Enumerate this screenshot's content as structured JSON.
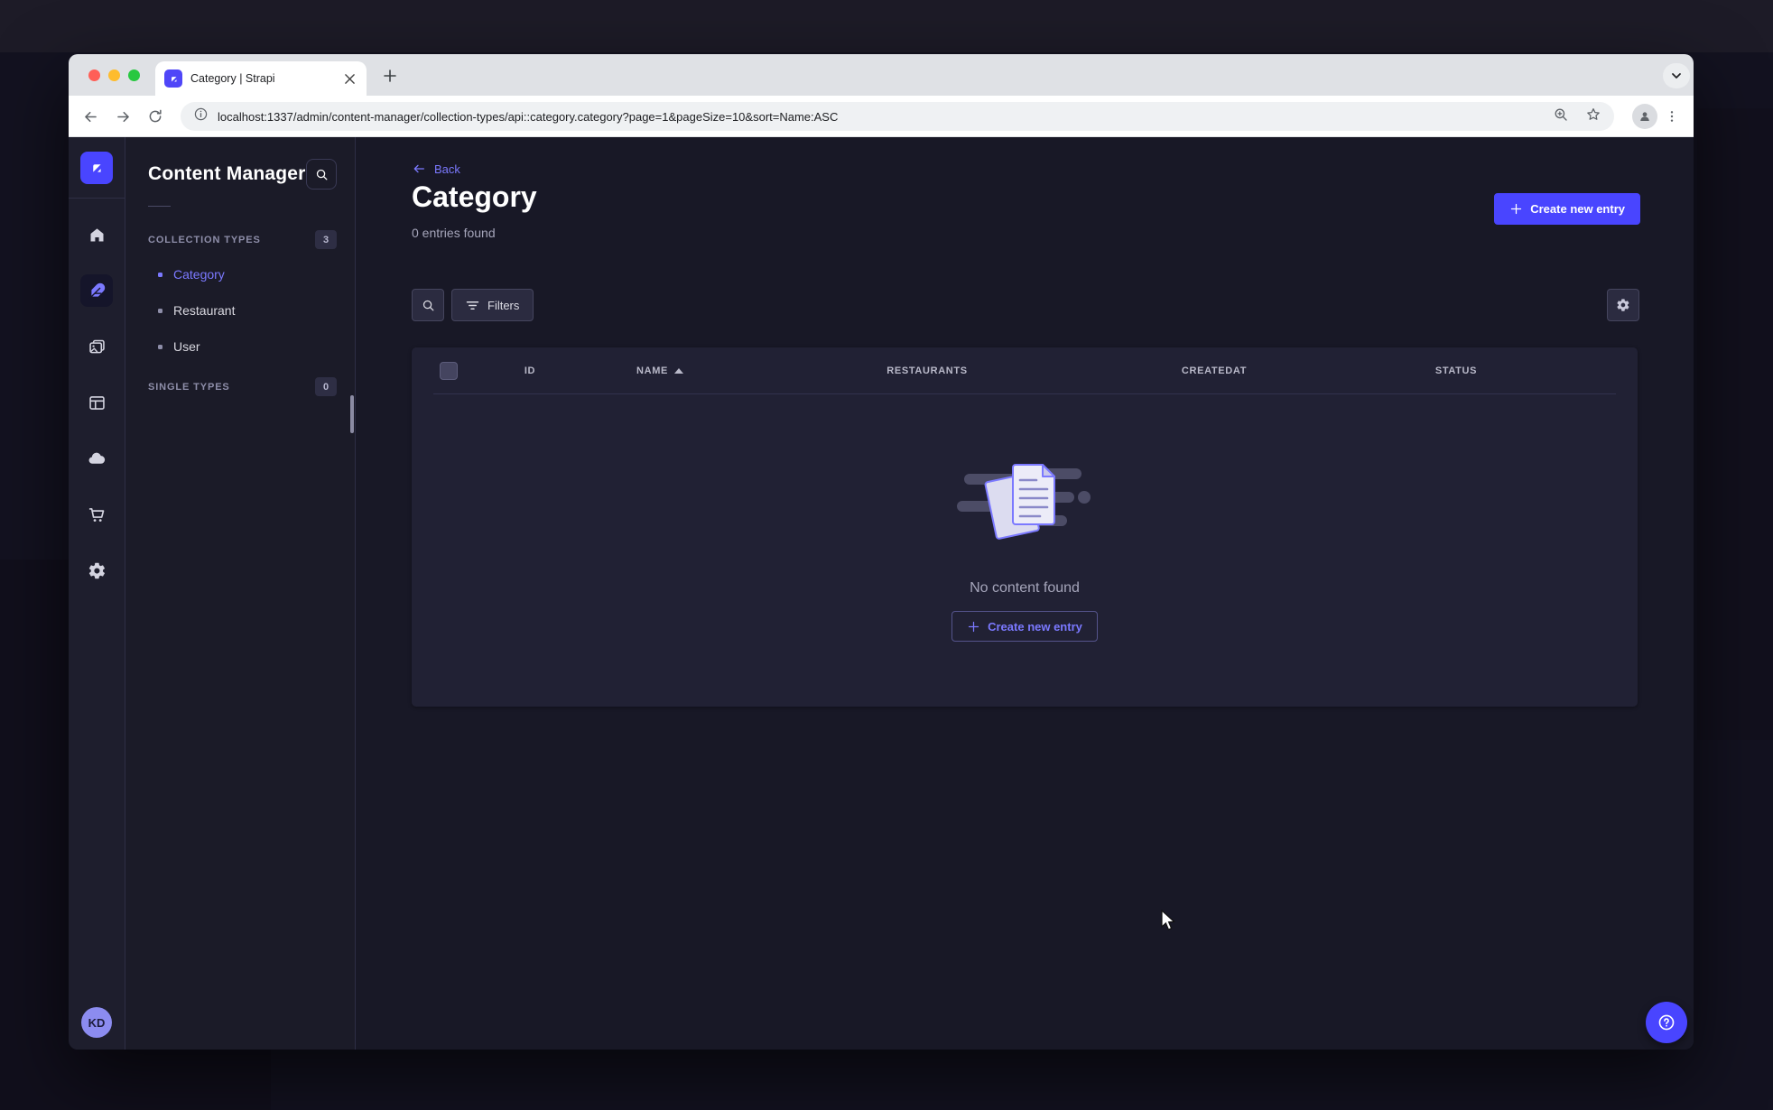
{
  "browser": {
    "tab_title": "Category | Strapi",
    "url": "localhost:1337/admin/content-manager/collection-types/api::category.category?page=1&pageSize=10&sort=Name:ASC"
  },
  "nav_rail": {
    "avatar_initials": "KD",
    "icons": [
      "strapi-logo",
      "home",
      "content-manager-feather",
      "media-library",
      "content-type-builder",
      "deploy-cloud",
      "marketplace-cart",
      "settings-gear"
    ]
  },
  "subnav": {
    "title": "Content Manager",
    "sections": [
      {
        "label": "COLLECTION TYPES",
        "badge": "3",
        "items": [
          {
            "label": "Category",
            "active": true
          },
          {
            "label": "Restaurant",
            "active": false
          },
          {
            "label": "User",
            "active": false
          }
        ]
      },
      {
        "label": "SINGLE TYPES",
        "badge": "0",
        "items": []
      }
    ]
  },
  "main": {
    "back_label": "Back",
    "title": "Category",
    "subtitle": "0 entries found",
    "create_button_label": "Create new entry",
    "filters_label": "Filters",
    "table": {
      "columns": [
        "ID",
        "NAME",
        "RESTAURANTS",
        "CREATEDAT",
        "STATUS"
      ],
      "sorted_column": "NAME",
      "sort_direction": "asc",
      "rows": []
    },
    "empty": {
      "message": "No content found",
      "button_label": "Create new entry"
    }
  },
  "colors": {
    "primary": "#4945ff",
    "primary_text": "#7b79ff",
    "app_background": "#181826",
    "surface": "#212134",
    "subnav_background": "#1b1b28"
  }
}
